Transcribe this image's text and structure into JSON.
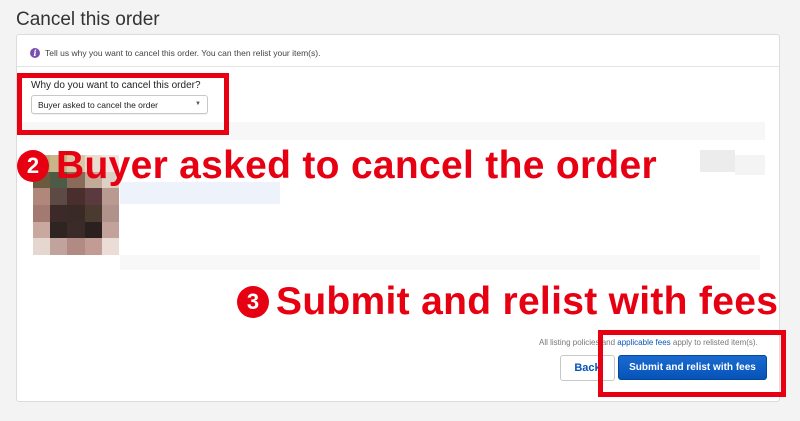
{
  "page": {
    "title": "Cancel this order"
  },
  "info": {
    "icon": "info-icon",
    "text": "Tell us why you want to cancel this order. You can then relist your item(s)."
  },
  "reason": {
    "label": "Why do you want to cancel this order?",
    "selected": "Buyer asked to cancel the order"
  },
  "annotations": {
    "step2_number": "2",
    "step2_text": "Buyer asked to cancel the order",
    "step3_number": "3",
    "step3_text": "Submit and relist with fees",
    "highlight_color": "#e60012"
  },
  "footer": {
    "policy_prefix": "All listing policies and",
    "policy_link": "applicable fees",
    "policy_suffix": "apply to relisted item(s).",
    "back_label": "Back",
    "submit_label": "Submit and relist with fees",
    "submit_color": "#0654ba"
  }
}
